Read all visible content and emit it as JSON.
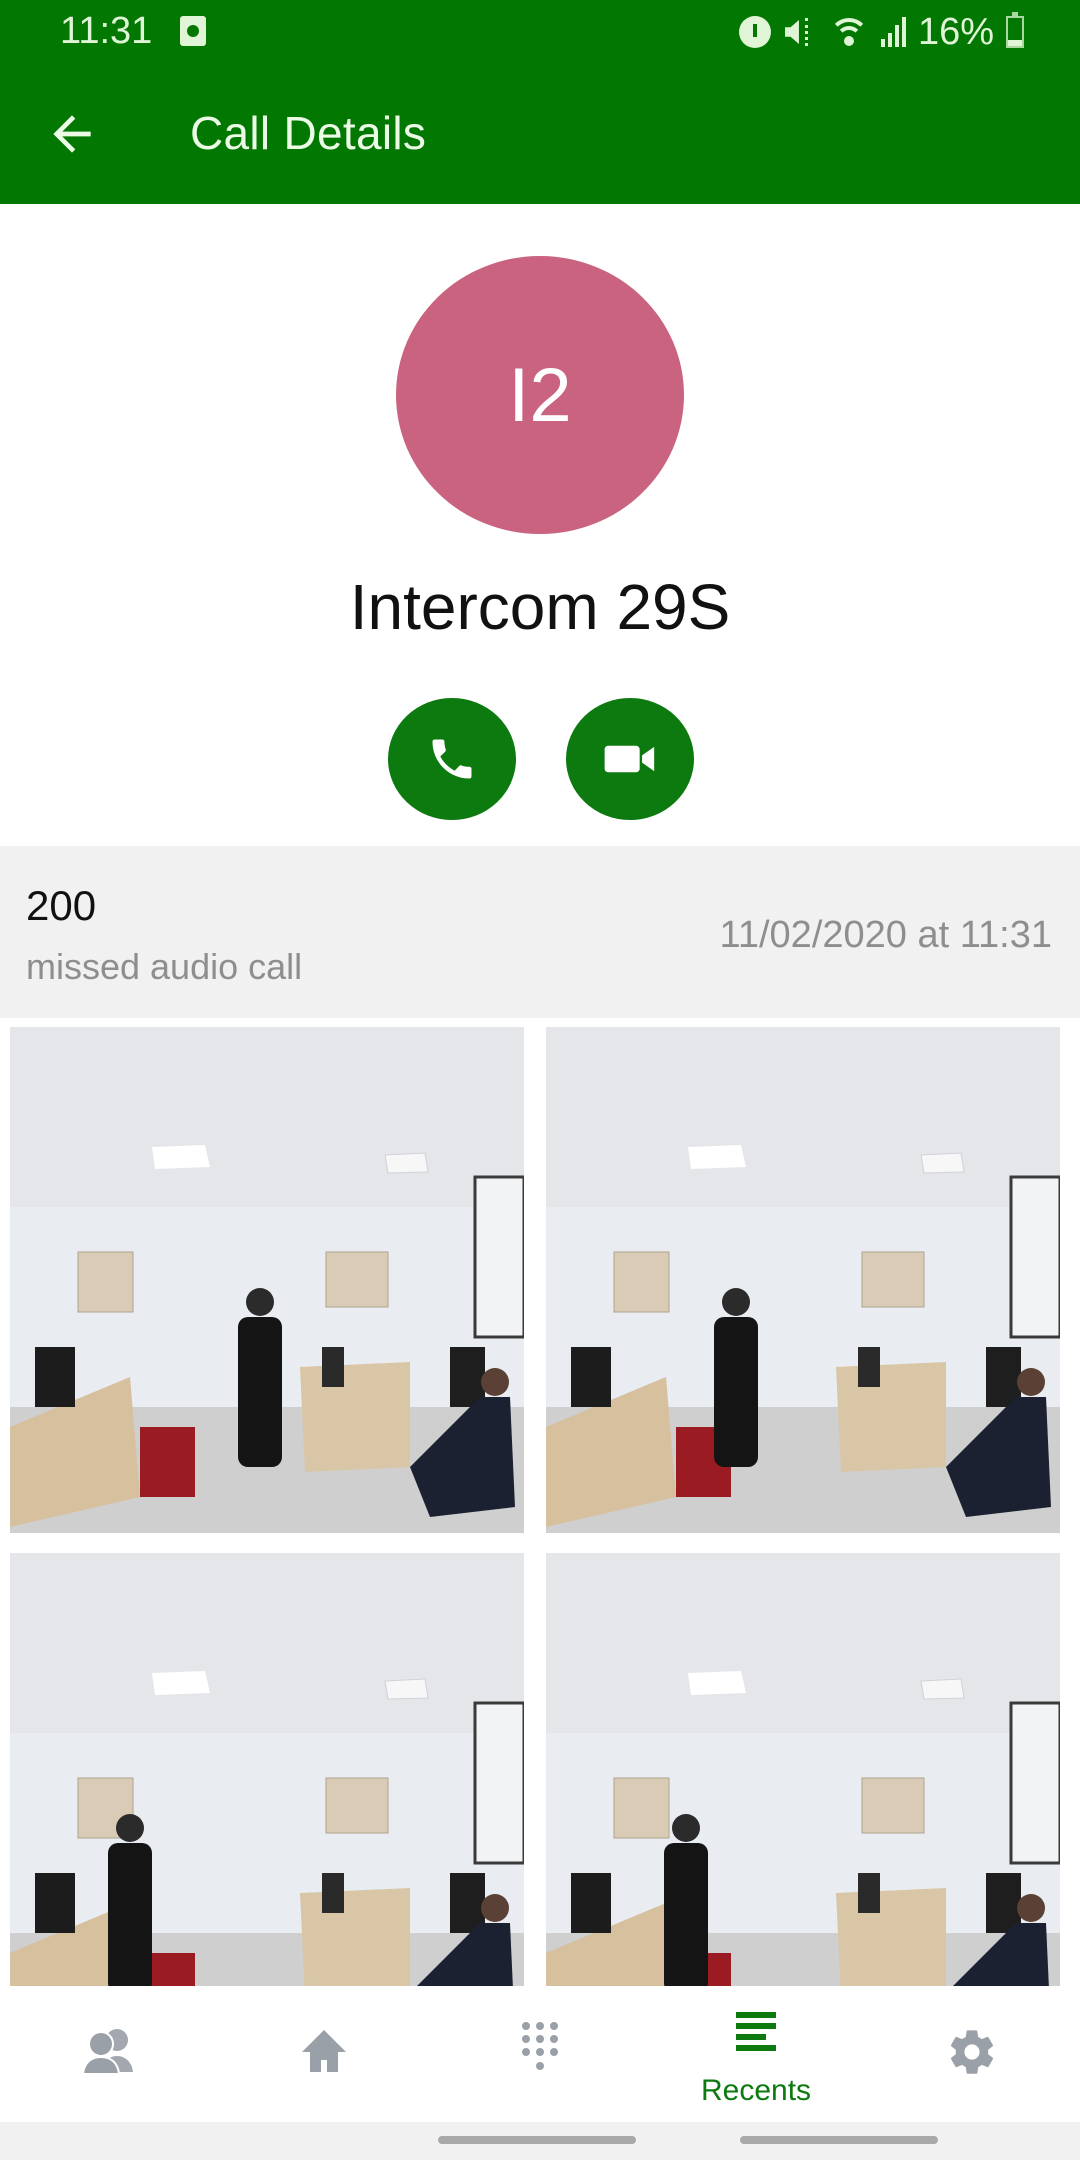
{
  "status_bar": {
    "time": "11:31",
    "icons": [
      "notification-icon",
      "alarm-icon",
      "mute-icon",
      "wifi-icon",
      "signal-icon",
      "battery-icon"
    ],
    "battery_percent": "16%",
    "battery_level": 0.16
  },
  "app_bar": {
    "back_icon": "arrow-left-icon",
    "title": "Call Details"
  },
  "contact": {
    "avatar_initials": "I2",
    "avatar_color": "#c9637f",
    "name": "Intercom 29S",
    "actions": [
      {
        "icon": "phone-icon",
        "label": "Audio call"
      },
      {
        "icon": "video-camera-icon",
        "label": "Video call"
      }
    ]
  },
  "call_entry": {
    "number": "200",
    "type": "missed audio call",
    "datetime": "11/02/2020 at 11:31"
  },
  "snapshots": {
    "count_visible": 4,
    "description": "Intercom camera snapshots of an office"
  },
  "bottom_nav": {
    "items": [
      {
        "icon": "contacts-icon",
        "label": ""
      },
      {
        "icon": "home-icon",
        "label": ""
      },
      {
        "icon": "dialpad-icon",
        "label": ""
      },
      {
        "icon": "recents-icon",
        "label": "Recents",
        "active": true
      },
      {
        "icon": "gear-icon",
        "label": ""
      }
    ]
  },
  "colors": {
    "primary": "#027802",
    "action_button": "#0d7a10",
    "inactive_icon": "#9aa0a8",
    "secondary_text": "#8e8e8e",
    "row_background": "#f1f1f1"
  }
}
